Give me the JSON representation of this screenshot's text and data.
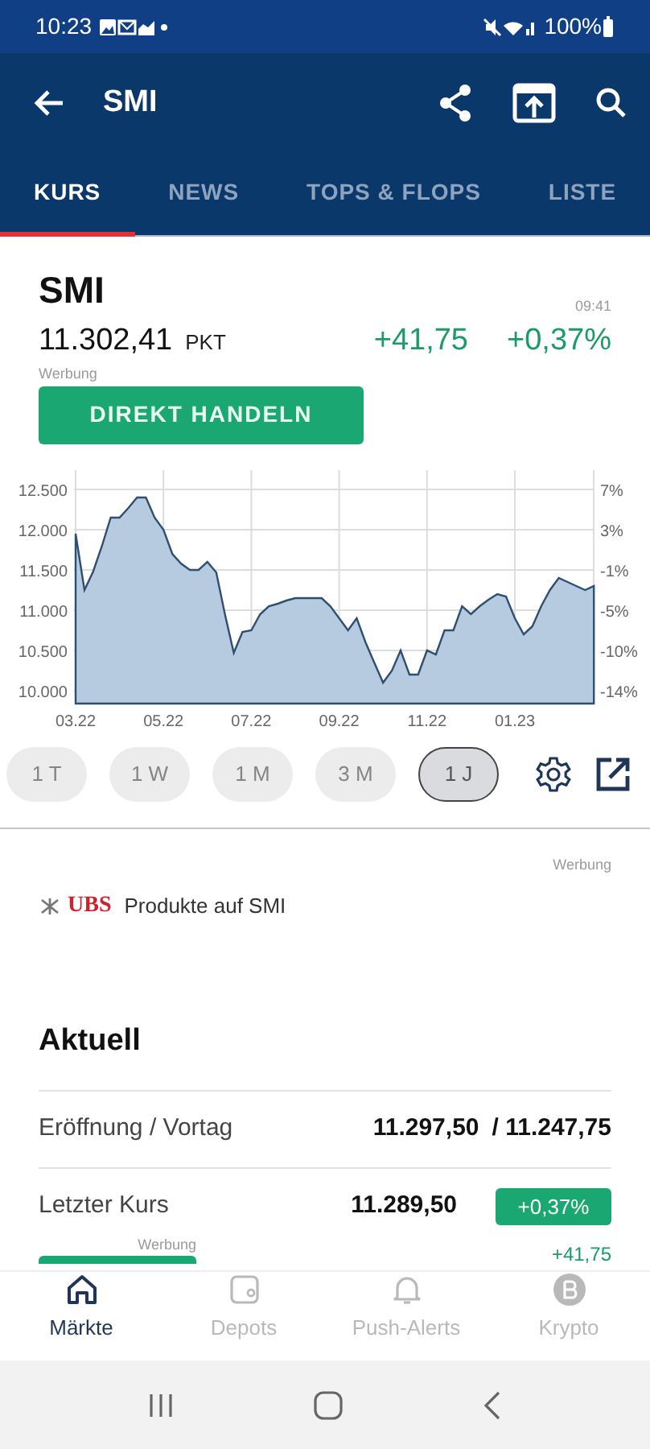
{
  "status_bar": {
    "time": "10:23",
    "battery": "100%"
  },
  "app_bar": {
    "title": "SMI"
  },
  "tabs": [
    {
      "label": "KURS",
      "selected": true
    },
    {
      "label": "NEWS",
      "selected": false
    },
    {
      "label": "TOPS & FLOPS",
      "selected": false
    },
    {
      "label": "LISTE",
      "selected": false
    }
  ],
  "quote": {
    "name": "SMI",
    "time": "09:41",
    "price": "11.302,41",
    "unit": "PKT",
    "change": "+41,75",
    "change_percent": "+0,37%",
    "ad_label": "Werbung",
    "trade_button": "DIREKT HANDELN"
  },
  "chart": {
    "percent_ticks": [
      "7%",
      "3%",
      "-1%",
      "-5%",
      "-10%",
      "-14%"
    ],
    "chart_data": {
      "type": "area",
      "grid": true,
      "ylim": [
        9840,
        12740
      ],
      "categories": [
        "03.22",
        null,
        null,
        null,
        null,
        null,
        null,
        null,
        null,
        null,
        "05.22",
        null,
        null,
        null,
        null,
        null,
        null,
        null,
        null,
        null,
        "07.22",
        null,
        null,
        null,
        null,
        null,
        null,
        null,
        null,
        null,
        "09.22",
        null,
        null,
        null,
        null,
        null,
        null,
        null,
        null,
        null,
        "11.22",
        null,
        null,
        null,
        null,
        null,
        null,
        null,
        null,
        null,
        "01.23",
        null,
        null,
        null,
        null,
        null,
        null,
        null,
        null,
        null
      ],
      "yticks": [
        {
          "value": 10000,
          "label": "10.000"
        },
        {
          "value": 10500,
          "label": "10.500"
        },
        {
          "value": 11000,
          "label": "11.000"
        },
        {
          "value": 11500,
          "label": "11.500"
        },
        {
          "value": 12000,
          "label": "12.000"
        },
        {
          "value": 12500,
          "label": "12.500"
        }
      ],
      "series": [
        {
          "color": "#2f4f72",
          "values": [
            11950,
            11250,
            11480,
            11800,
            12150,
            12150,
            12270,
            12400,
            12400,
            12150,
            12000,
            11700,
            11580,
            11500,
            11500,
            11600,
            11470,
            10950,
            10470,
            10730,
            10750,
            10950,
            11050,
            11080,
            11120,
            11150,
            11150,
            11150,
            11150,
            11050,
            10900,
            10750,
            10900,
            10600,
            10350,
            10100,
            10250,
            10500,
            10200,
            10200,
            10500,
            10450,
            10750,
            10750,
            11050,
            10950,
            11050,
            11130,
            11200,
            11170,
            10900,
            10700,
            10800,
            11050,
            11250,
            11400,
            11350,
            11300,
            11250,
            11300
          ]
        }
      ]
    }
  },
  "ranges": [
    {
      "label": "1 T",
      "selected": false
    },
    {
      "label": "1 W",
      "selected": false
    },
    {
      "label": "1 M",
      "selected": false
    },
    {
      "label": "3 M",
      "selected": false
    },
    {
      "label": "1 J",
      "selected": true
    }
  ],
  "promo": {
    "ad_label": "Werbung",
    "brand": "UBS",
    "text": "Produkte auf SMI"
  },
  "current": {
    "title": "Aktuell",
    "rows": [
      {
        "kind": "pair",
        "label": "Eröffnung / Vortag",
        "value": "11.297,50",
        "value_2": "/ 11.247,75"
      },
      {
        "kind": "last",
        "label": "Letzter Kurs",
        "value": "11.289,50",
        "badge": "+0,37%"
      }
    ],
    "partial_row": {
      "ad_label": "Werbung",
      "change": "+41,75"
    }
  },
  "bottom_nav": [
    {
      "label": "Märkte",
      "selected": true
    },
    {
      "label": "Depots",
      "selected": false
    },
    {
      "label": "Push-Alerts",
      "selected": false
    },
    {
      "label": "Krypto",
      "selected": false
    }
  ]
}
